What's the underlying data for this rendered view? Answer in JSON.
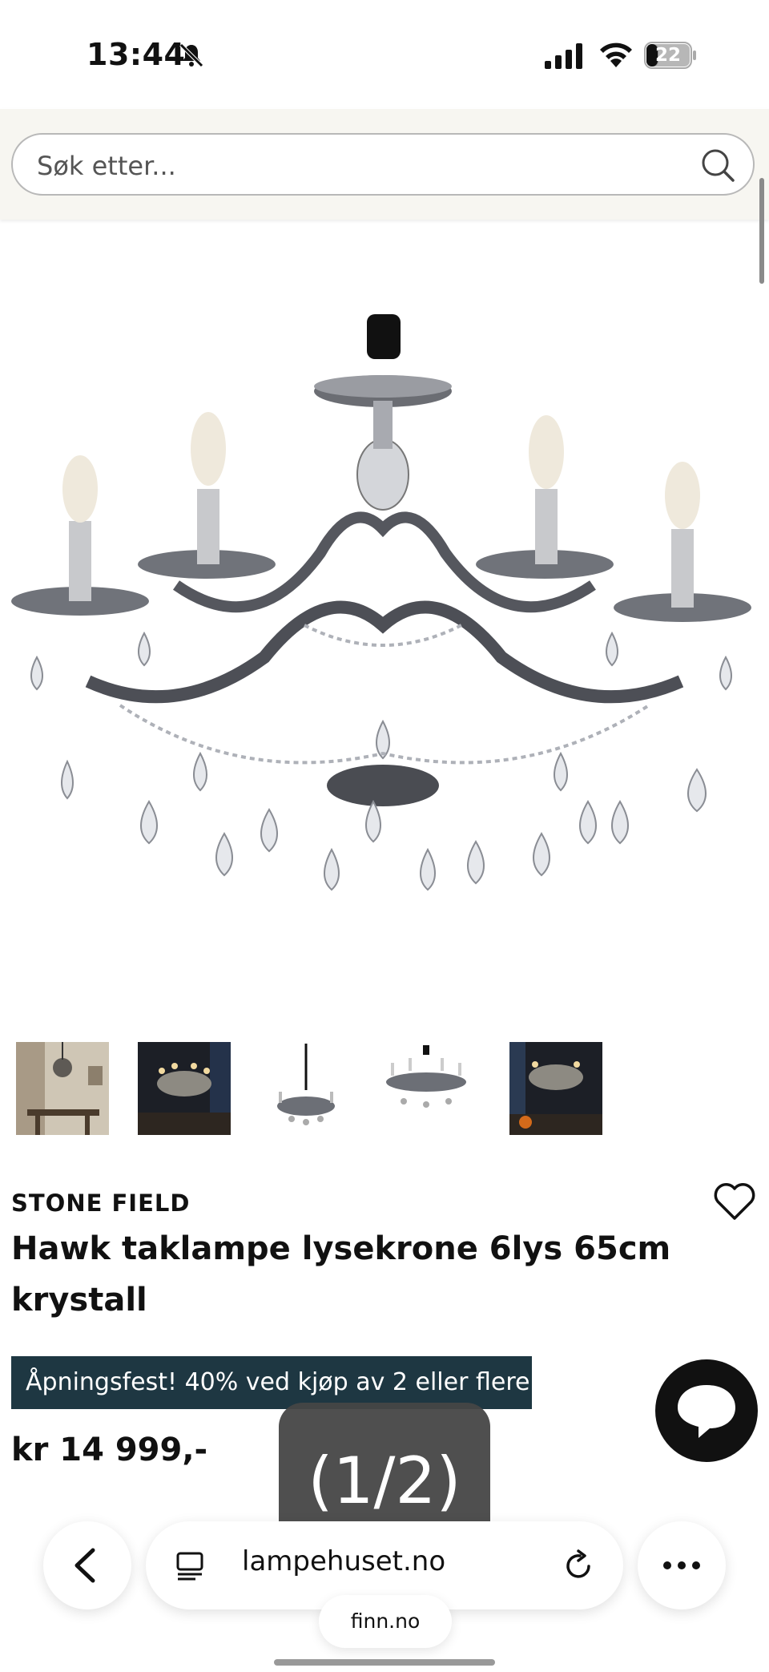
{
  "status_bar": {
    "time": "13:44",
    "battery": "22"
  },
  "search": {
    "placeholder": "Søk etter..."
  },
  "thumbnail_icons": [
    "room-photo",
    "dark-room-photo",
    "chandelier-hanging",
    "chandelier-front",
    "dark-room-photo-2"
  ],
  "product": {
    "brand": "STONE FIELD",
    "title": "Hawk taklampe lysekrone 6lys 65cm krystall",
    "promo": "Åpningsfest! 40% ved kjøp av 2 eller flere",
    "price": "kr 14 999,-"
  },
  "overlay": {
    "page_indicator": "(1/2)"
  },
  "browser": {
    "url": "lampehuset.no",
    "tab_label": "finn.no"
  },
  "colors": {
    "promo_bg": "#1e3742",
    "chat_bg": "#111111",
    "search_band": "#f7f6f1"
  }
}
